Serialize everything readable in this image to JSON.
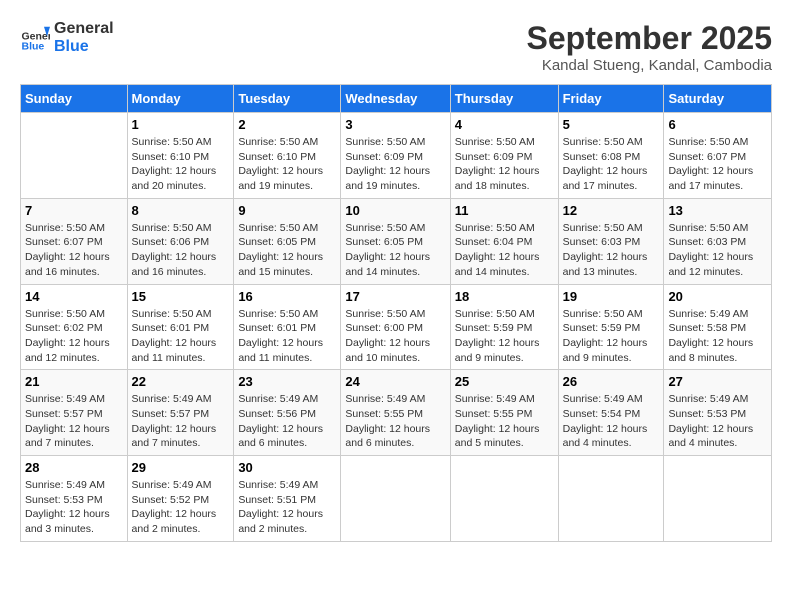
{
  "header": {
    "logo_general": "General",
    "logo_blue": "Blue",
    "month": "September 2025",
    "location": "Kandal Stueng, Kandal, Cambodia"
  },
  "days_of_week": [
    "Sunday",
    "Monday",
    "Tuesday",
    "Wednesday",
    "Thursday",
    "Friday",
    "Saturday"
  ],
  "weeks": [
    [
      {
        "day": "",
        "info": ""
      },
      {
        "day": "1",
        "info": "Sunrise: 5:50 AM\nSunset: 6:10 PM\nDaylight: 12 hours\nand 20 minutes."
      },
      {
        "day": "2",
        "info": "Sunrise: 5:50 AM\nSunset: 6:10 PM\nDaylight: 12 hours\nand 19 minutes."
      },
      {
        "day": "3",
        "info": "Sunrise: 5:50 AM\nSunset: 6:09 PM\nDaylight: 12 hours\nand 19 minutes."
      },
      {
        "day": "4",
        "info": "Sunrise: 5:50 AM\nSunset: 6:09 PM\nDaylight: 12 hours\nand 18 minutes."
      },
      {
        "day": "5",
        "info": "Sunrise: 5:50 AM\nSunset: 6:08 PM\nDaylight: 12 hours\nand 17 minutes."
      },
      {
        "day": "6",
        "info": "Sunrise: 5:50 AM\nSunset: 6:07 PM\nDaylight: 12 hours\nand 17 minutes."
      }
    ],
    [
      {
        "day": "7",
        "info": "Sunrise: 5:50 AM\nSunset: 6:07 PM\nDaylight: 12 hours\nand 16 minutes."
      },
      {
        "day": "8",
        "info": "Sunrise: 5:50 AM\nSunset: 6:06 PM\nDaylight: 12 hours\nand 16 minutes."
      },
      {
        "day": "9",
        "info": "Sunrise: 5:50 AM\nSunset: 6:05 PM\nDaylight: 12 hours\nand 15 minutes."
      },
      {
        "day": "10",
        "info": "Sunrise: 5:50 AM\nSunset: 6:05 PM\nDaylight: 12 hours\nand 14 minutes."
      },
      {
        "day": "11",
        "info": "Sunrise: 5:50 AM\nSunset: 6:04 PM\nDaylight: 12 hours\nand 14 minutes."
      },
      {
        "day": "12",
        "info": "Sunrise: 5:50 AM\nSunset: 6:03 PM\nDaylight: 12 hours\nand 13 minutes."
      },
      {
        "day": "13",
        "info": "Sunrise: 5:50 AM\nSunset: 6:03 PM\nDaylight: 12 hours\nand 12 minutes."
      }
    ],
    [
      {
        "day": "14",
        "info": "Sunrise: 5:50 AM\nSunset: 6:02 PM\nDaylight: 12 hours\nand 12 minutes."
      },
      {
        "day": "15",
        "info": "Sunrise: 5:50 AM\nSunset: 6:01 PM\nDaylight: 12 hours\nand 11 minutes."
      },
      {
        "day": "16",
        "info": "Sunrise: 5:50 AM\nSunset: 6:01 PM\nDaylight: 12 hours\nand 11 minutes."
      },
      {
        "day": "17",
        "info": "Sunrise: 5:50 AM\nSunset: 6:00 PM\nDaylight: 12 hours\nand 10 minutes."
      },
      {
        "day": "18",
        "info": "Sunrise: 5:50 AM\nSunset: 5:59 PM\nDaylight: 12 hours\nand 9 minutes."
      },
      {
        "day": "19",
        "info": "Sunrise: 5:50 AM\nSunset: 5:59 PM\nDaylight: 12 hours\nand 9 minutes."
      },
      {
        "day": "20",
        "info": "Sunrise: 5:49 AM\nSunset: 5:58 PM\nDaylight: 12 hours\nand 8 minutes."
      }
    ],
    [
      {
        "day": "21",
        "info": "Sunrise: 5:49 AM\nSunset: 5:57 PM\nDaylight: 12 hours\nand 7 minutes."
      },
      {
        "day": "22",
        "info": "Sunrise: 5:49 AM\nSunset: 5:57 PM\nDaylight: 12 hours\nand 7 minutes."
      },
      {
        "day": "23",
        "info": "Sunrise: 5:49 AM\nSunset: 5:56 PM\nDaylight: 12 hours\nand 6 minutes."
      },
      {
        "day": "24",
        "info": "Sunrise: 5:49 AM\nSunset: 5:55 PM\nDaylight: 12 hours\nand 6 minutes."
      },
      {
        "day": "25",
        "info": "Sunrise: 5:49 AM\nSunset: 5:55 PM\nDaylight: 12 hours\nand 5 minutes."
      },
      {
        "day": "26",
        "info": "Sunrise: 5:49 AM\nSunset: 5:54 PM\nDaylight: 12 hours\nand 4 minutes."
      },
      {
        "day": "27",
        "info": "Sunrise: 5:49 AM\nSunset: 5:53 PM\nDaylight: 12 hours\nand 4 minutes."
      }
    ],
    [
      {
        "day": "28",
        "info": "Sunrise: 5:49 AM\nSunset: 5:53 PM\nDaylight: 12 hours\nand 3 minutes."
      },
      {
        "day": "29",
        "info": "Sunrise: 5:49 AM\nSunset: 5:52 PM\nDaylight: 12 hours\nand 2 minutes."
      },
      {
        "day": "30",
        "info": "Sunrise: 5:49 AM\nSunset: 5:51 PM\nDaylight: 12 hours\nand 2 minutes."
      },
      {
        "day": "",
        "info": ""
      },
      {
        "day": "",
        "info": ""
      },
      {
        "day": "",
        "info": ""
      },
      {
        "day": "",
        "info": ""
      }
    ]
  ]
}
